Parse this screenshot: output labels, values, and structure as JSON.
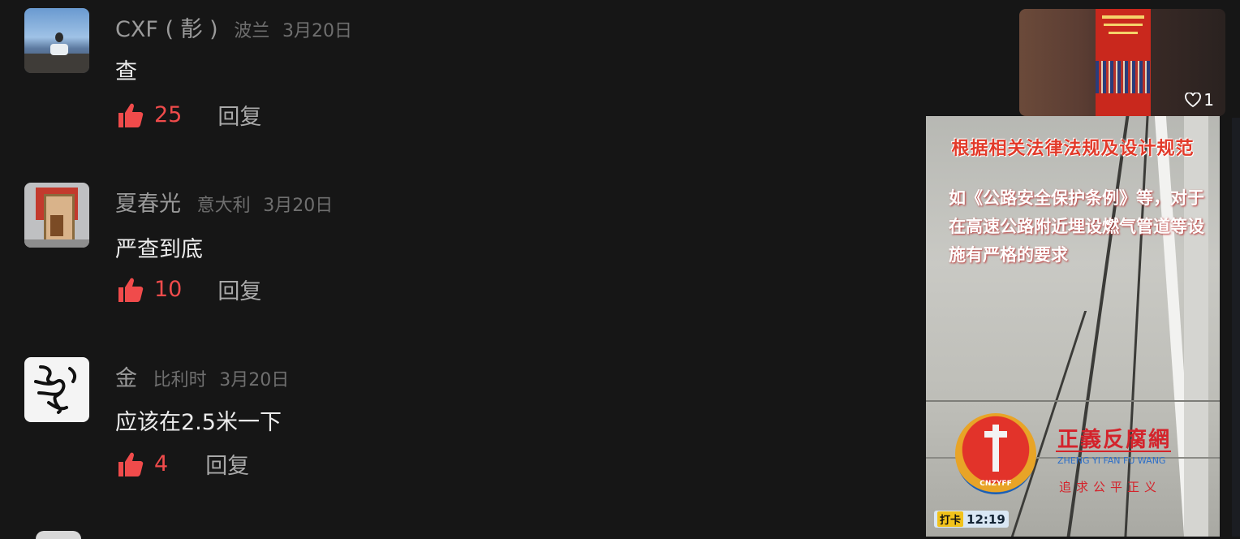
{
  "comments": [
    {
      "name": "CXF(𠀀)",
      "name_display": "CXF ( 𩇕 )",
      "location": "波兰",
      "date": "3月20日",
      "text": "查",
      "likes": "25",
      "reply": "回复"
    },
    {
      "name": "夏春光",
      "location": "意大利",
      "date": "3月20日",
      "text": "严查到底",
      "likes": "10",
      "reply": "回复"
    },
    {
      "name": "金",
      "location": "比利时",
      "date": "3月20日",
      "text": "应该在2.5米一下",
      "likes": "4",
      "reply": "回复"
    }
  ],
  "side_thumbnail": {
    "likes": "1"
  },
  "video": {
    "headline": "根据相关法律法规及设计规范",
    "caption": "如《公路安全保护条例》等，对于在高速公路附近埋设燃气管道等设施有严格的要求",
    "logo_tag": "CNZYFF",
    "brand": "正義反腐網",
    "pinyin": "ZHENG YI FAN FU WANG",
    "slogan": "追求公平正义",
    "timestamp_tag": "打卡",
    "timestamp": "12:19"
  },
  "colors": {
    "background": "#161616",
    "like": "#f04b4b",
    "brand_red": "#d4232b"
  }
}
